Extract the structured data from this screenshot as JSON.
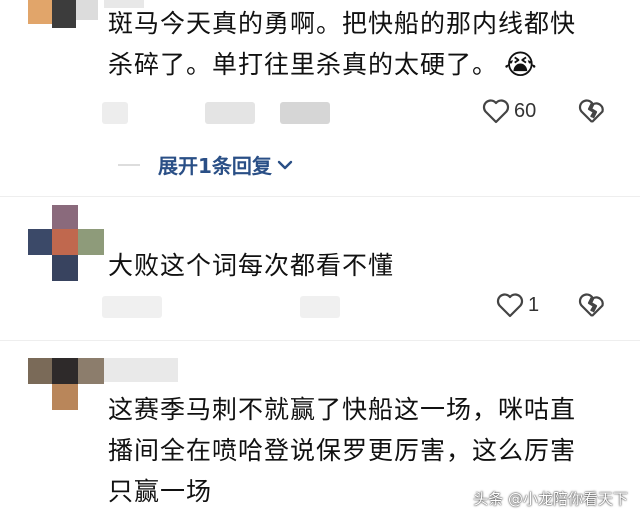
{
  "comments": [
    {
      "text_lines": [
        "斑马今天真的勇啊。把快船的那内线都快",
        "杀碎了。单打往里杀真的太硬了。"
      ],
      "emoji": "😭",
      "likes": "60",
      "reply_label": "展开1条回复"
    },
    {
      "text_lines": [
        "大败这个词每次都看不懂"
      ],
      "likes": "1"
    },
    {
      "text_lines": [
        "这赛季马刺不就赢了快船这一场，咪咕直",
        "播间全在喷哈登说保罗更厉害，这么厉害",
        "只赢一场"
      ]
    }
  ],
  "watermark": "头条 @小龙陪你看天下",
  "icons": [
    "heart-icon",
    "broken-heart-icon",
    "chevron-down-icon",
    "crying-emoji"
  ],
  "colors": {
    "link_blue": "#2a4f86",
    "text": "#111111"
  }
}
